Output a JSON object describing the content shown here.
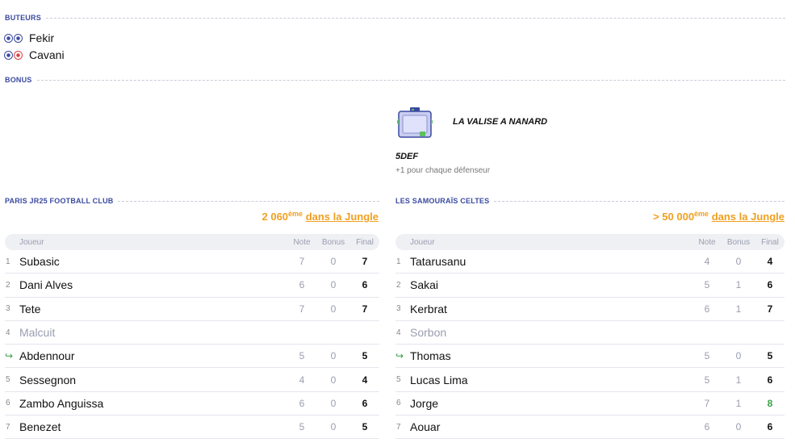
{
  "scorers": {
    "label": "BUTEURS",
    "list": [
      {
        "name": "Fekir",
        "own": false
      },
      {
        "name": "Cavani",
        "own": true
      }
    ]
  },
  "bonus": {
    "label": "BONUS",
    "name": "LA VALISE A NANARD",
    "code": "5DEF",
    "description": "+1 pour chaque défenseur"
  },
  "home": {
    "team": "PARIS JR25 FOOTBALL CLUB",
    "rank_value": "2 060",
    "rank_suffix": "ème",
    "rank_link": "dans la Jungle",
    "columns": {
      "player": "Joueur",
      "note": "Note",
      "bonus": "Bonus",
      "final": "Final"
    },
    "rows": [
      {
        "num": "1",
        "name": "Subasic",
        "note": "7",
        "bonus": "0",
        "final": "7"
      },
      {
        "num": "2",
        "name": "Dani Alves",
        "note": "6",
        "bonus": "0",
        "final": "6"
      },
      {
        "num": "3",
        "name": "Tete",
        "note": "7",
        "bonus": "0",
        "final": "7"
      },
      {
        "num": "4",
        "name": "Malcuit",
        "note": "",
        "bonus": "",
        "final": ""
      },
      {
        "num": "",
        "name": "Abdennour",
        "note": "5",
        "bonus": "0",
        "final": "5"
      },
      {
        "num": "5",
        "name": "Sessegnon",
        "note": "4",
        "bonus": "0",
        "final": "4"
      },
      {
        "num": "6",
        "name": "Zambo Anguissa",
        "note": "6",
        "bonus": "0",
        "final": "6"
      },
      {
        "num": "7",
        "name": "Benezet",
        "note": "5",
        "bonus": "0",
        "final": "5"
      }
    ]
  },
  "away": {
    "team": "LES SAMOURAÏS CELTES",
    "rank_value": "> 50 000",
    "rank_suffix": "ème",
    "rank_link": "dans la Jungle",
    "columns": {
      "player": "Joueur",
      "note": "Note",
      "bonus": "Bonus",
      "final": "Final"
    },
    "rows": [
      {
        "num": "1",
        "name": "Tatarusanu",
        "note": "4",
        "bonus": "0",
        "final": "4"
      },
      {
        "num": "2",
        "name": "Sakai",
        "note": "5",
        "bonus": "1",
        "final": "6"
      },
      {
        "num": "3",
        "name": "Kerbrat",
        "note": "6",
        "bonus": "1",
        "final": "7"
      },
      {
        "num": "4",
        "name": "Sorbon",
        "note": "",
        "bonus": "",
        "final": ""
      },
      {
        "num": "",
        "name": "Thomas",
        "note": "5",
        "bonus": "0",
        "final": "5"
      },
      {
        "num": "5",
        "name": "Lucas Lima",
        "note": "5",
        "bonus": "1",
        "final": "6"
      },
      {
        "num": "6",
        "name": "Jorge",
        "note": "7",
        "bonus": "1",
        "final": "8"
      },
      {
        "num": "7",
        "name": "Aouar",
        "note": "6",
        "bonus": "0",
        "final": "6"
      }
    ]
  },
  "colors": {
    "accent": "#3a4aa0",
    "rank": "#f0a020",
    "positive": "#3aa048"
  }
}
